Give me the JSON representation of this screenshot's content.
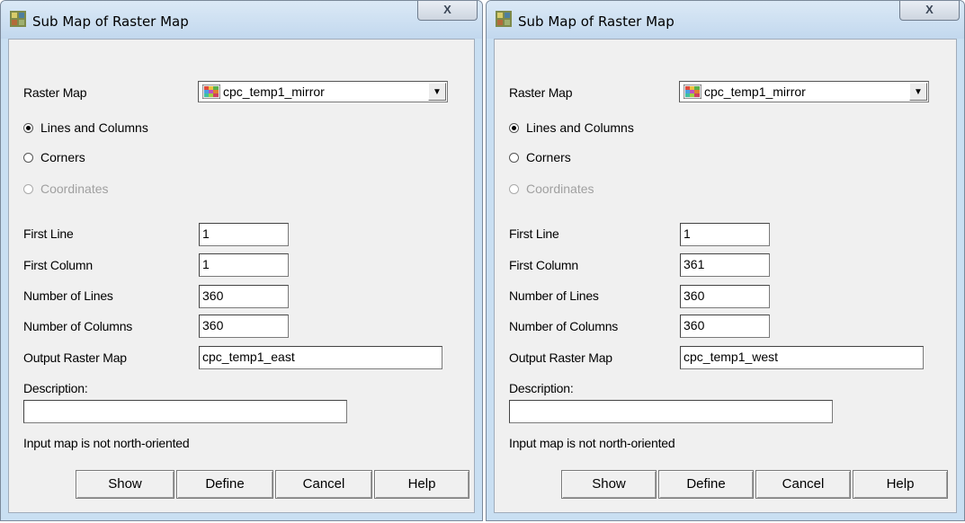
{
  "left": {
    "title": "Sub Map of Raster Map",
    "close_label": "X",
    "raster_map_label": "Raster Map",
    "raster_map_value": "cpc_temp1_mirror",
    "options": [
      {
        "label": "Lines and Columns",
        "checked": true,
        "disabled": false
      },
      {
        "label": "Corners",
        "checked": false,
        "disabled": false
      },
      {
        "label": "Coordinates",
        "checked": false,
        "disabled": true
      }
    ],
    "first_line_label": "First Line",
    "first_line_value": "1",
    "first_column_label": "First Column",
    "first_column_value": "1",
    "num_lines_label": "Number of Lines",
    "num_lines_value": "360",
    "num_columns_label": "Number of Columns",
    "num_columns_value": "360",
    "output_label": "Output Raster Map",
    "output_value": "cpc_temp1_east",
    "description_label": "Description:",
    "description_value": "",
    "status_text": "Input map is not north-oriented",
    "buttons": {
      "show": "Show",
      "define": "Define",
      "cancel": "Cancel",
      "help": "Help"
    }
  },
  "right": {
    "title": "Sub Map of Raster Map",
    "close_label": "X",
    "raster_map_label": "Raster Map",
    "raster_map_value": "cpc_temp1_mirror",
    "options": [
      {
        "label": "Lines and Columns",
        "checked": true,
        "disabled": false
      },
      {
        "label": "Corners",
        "checked": false,
        "disabled": false
      },
      {
        "label": "Coordinates",
        "checked": false,
        "disabled": true
      }
    ],
    "first_line_label": "First Line",
    "first_line_value": "1",
    "first_column_label": "First Column",
    "first_column_value": "361",
    "num_lines_label": "Number of Lines",
    "num_lines_value": "360",
    "num_columns_label": "Number of Columns",
    "num_columns_value": "360",
    "output_label": "Output Raster Map",
    "output_value": "cpc_temp1_west",
    "description_label": "Description:",
    "description_value": "",
    "status_text": "Input map is not north-oriented",
    "buttons": {
      "show": "Show",
      "define": "Define",
      "cancel": "Cancel",
      "help": "Help"
    }
  }
}
